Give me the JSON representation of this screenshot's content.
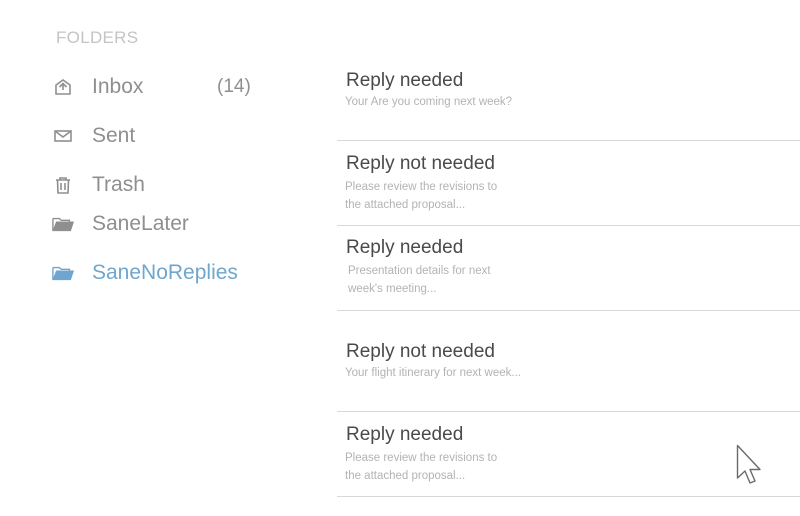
{
  "sidebar": {
    "heading": "FOLDERS",
    "items": [
      {
        "label": "Inbox",
        "count": "(14)",
        "icon": "inbox-icon"
      },
      {
        "label": "Sent",
        "icon": "envelope-icon"
      },
      {
        "label": "Trash",
        "icon": "trash-icon"
      },
      {
        "label": "SaneLater",
        "icon": "folder-icon"
      },
      {
        "label": "SaneNoReplies",
        "icon": "folder-icon",
        "active": true
      }
    ]
  },
  "messages": [
    {
      "subject": "Reply needed",
      "snippet": "Your Are you coming next week?"
    },
    {
      "subject": "Reply not needed",
      "snippet": "Please review the revisions to the attached proposal..."
    },
    {
      "subject": "Reply needed",
      "snippet": "Presentation details for next week's meeting..."
    },
    {
      "subject": "Reply not needed",
      "snippet": "Your flight itinerary for next week..."
    },
    {
      "subject": "Reply needed",
      "snippet": "Please review the revisions to the attached proposal..."
    }
  ],
  "colors": {
    "active_folder": "#6fa6cf",
    "text": "#8f8f8f",
    "heading": "#c4c4c4",
    "divider": "#d8d8d8"
  }
}
